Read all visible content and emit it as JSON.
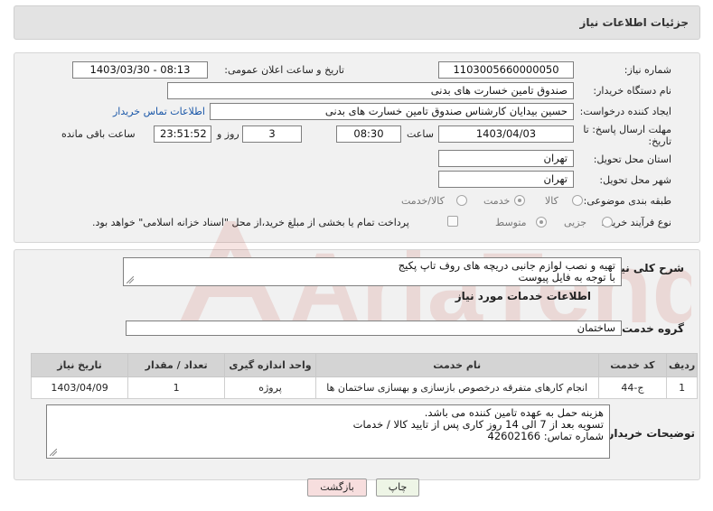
{
  "header": {
    "title": "جزئیات اطلاعات نیاز"
  },
  "form": {
    "need_number": {
      "label": "شماره نیاز:",
      "value": "1103005660000050"
    },
    "announce": {
      "label": "تاریخ و ساعت اعلان عمومی:",
      "value": "1403/03/30 - 08:13"
    },
    "buyer_org": {
      "label": "نام دستگاه خریدار:",
      "value": "صندوق تامین خسارت های بدنی"
    },
    "creator": {
      "label": "ایجاد کننده درخواست:",
      "value": "حسین بیدایان کارشناس صندوق تامین خسارت های بدنی"
    },
    "contact_link": "اطلاعات تماس خریدار",
    "deadline": {
      "label_line1": "مهلت ارسال پاسخ: تا",
      "label_line2": "تاریخ:",
      "date": "1403/04/03",
      "time_label": "ساعت",
      "time": "08:30",
      "days": "3",
      "days_label": "روز و",
      "remaining": "23:51:52",
      "remaining_label": "ساعت باقی مانده"
    },
    "province": {
      "label": "استان محل تحویل:",
      "value": "تهران"
    },
    "city": {
      "label": "شهر محل تحویل:",
      "value": "تهران"
    },
    "category": {
      "label": "طبقه بندی موضوعی:",
      "options": [
        "کالا",
        "خدمت",
        "کالا/خدمت"
      ],
      "selected": "خدمت"
    },
    "process": {
      "label": "نوع فرآیند خرید :",
      "options": [
        "جزیی",
        "متوسط"
      ],
      "selected": "متوسط",
      "payment_note": "پرداخت تمام یا بخشی از مبلغ خرید،از محل \"اسناد خزانه اسلامی\" خواهد بود."
    }
  },
  "description": {
    "label": "شرح کلی نیاز:",
    "lines": [
      "تهیه و نصب لوازم جانبی دریچه های روف تاپ پکیج",
      "با توجه به فایل پیوست"
    ]
  },
  "services_section": {
    "title": "اطلاعات خدمات مورد نیاز",
    "group_label": "گروه خدمت:",
    "group_value": "ساختمان"
  },
  "table": {
    "headers": [
      "ردیف",
      "کد خدمت",
      "نام خدمت",
      "واحد اندازه گیری",
      "تعداد / مقدار",
      "تاریخ نیاز"
    ],
    "rows": [
      [
        "1",
        "ج-44",
        "انجام کارهای متفرقه درخصوص بازسازی و بهسازی ساختمان ها",
        "پروژه",
        "1",
        "1403/04/09"
      ]
    ]
  },
  "buyer_notes": {
    "label": "توضیحات خریدار:",
    "lines": [
      "هزینه حمل به عهده تامین کننده می باشد.",
      "تسویه بعد از 7 الی 14 روز کاری پس از تایید کالا / خدمات",
      "شماره تماس: 42602166"
    ]
  },
  "buttons": {
    "print": "چاپ",
    "back": "بازگشت"
  },
  "watermark": {
    "text": "AriaTender.neT"
  },
  "colors": {
    "link": "#1a57a8",
    "header_bg": "#e3e3e3",
    "table_header_bg": "#d4d4d4",
    "watermark": "#c0392b"
  }
}
